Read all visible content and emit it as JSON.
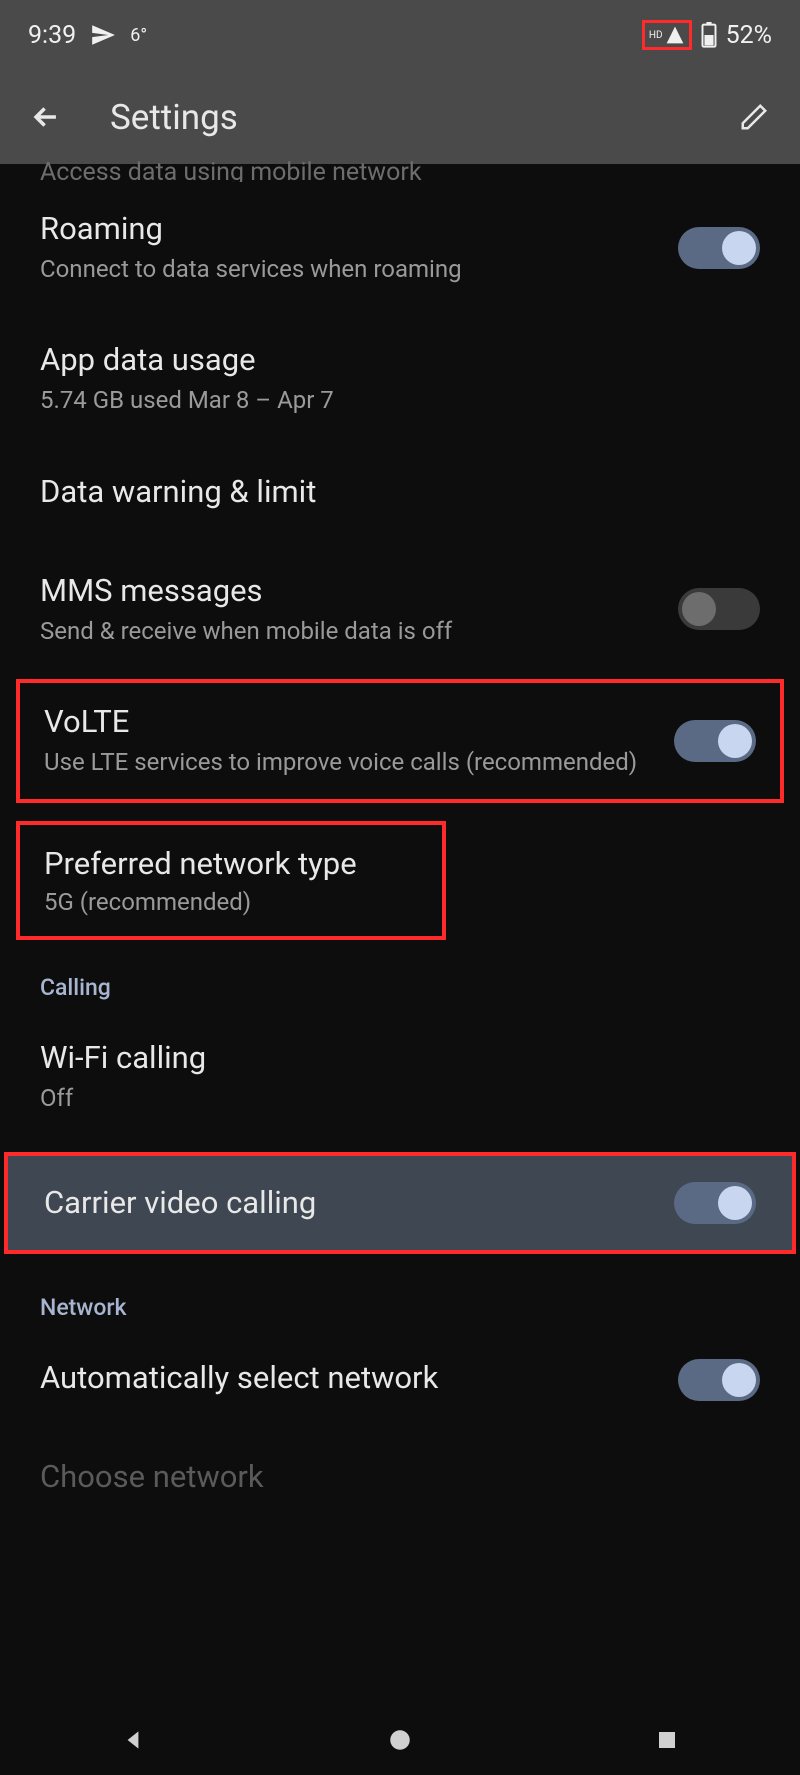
{
  "status": {
    "time": "9:39",
    "temp": "6°",
    "battery": "52%"
  },
  "appbar": {
    "title": "Settings"
  },
  "cut": {
    "text": "Access data using mobile network"
  },
  "roaming": {
    "title": "Roaming",
    "sub": "Connect to data services when roaming"
  },
  "appdata": {
    "title": "App data usage",
    "sub": "5.74 GB used Mar 8 – Apr 7"
  },
  "datawarn": {
    "title": "Data warning & limit"
  },
  "mms": {
    "title": "MMS messages",
    "sub": "Send & receive when mobile data is off"
  },
  "volte": {
    "title": "VoLTE",
    "sub": "Use LTE services to improve voice calls (recommended)"
  },
  "prefnet": {
    "title": "Preferred network type",
    "sub": "5G (recommended)"
  },
  "sections": {
    "calling": "Calling",
    "network": "Network"
  },
  "wificall": {
    "title": "Wi-Fi calling",
    "sub": "Off"
  },
  "carriervid": {
    "title": "Carrier video calling"
  },
  "autosel": {
    "title": "Automatically select network"
  },
  "choosenet": {
    "title": "Choose network"
  }
}
